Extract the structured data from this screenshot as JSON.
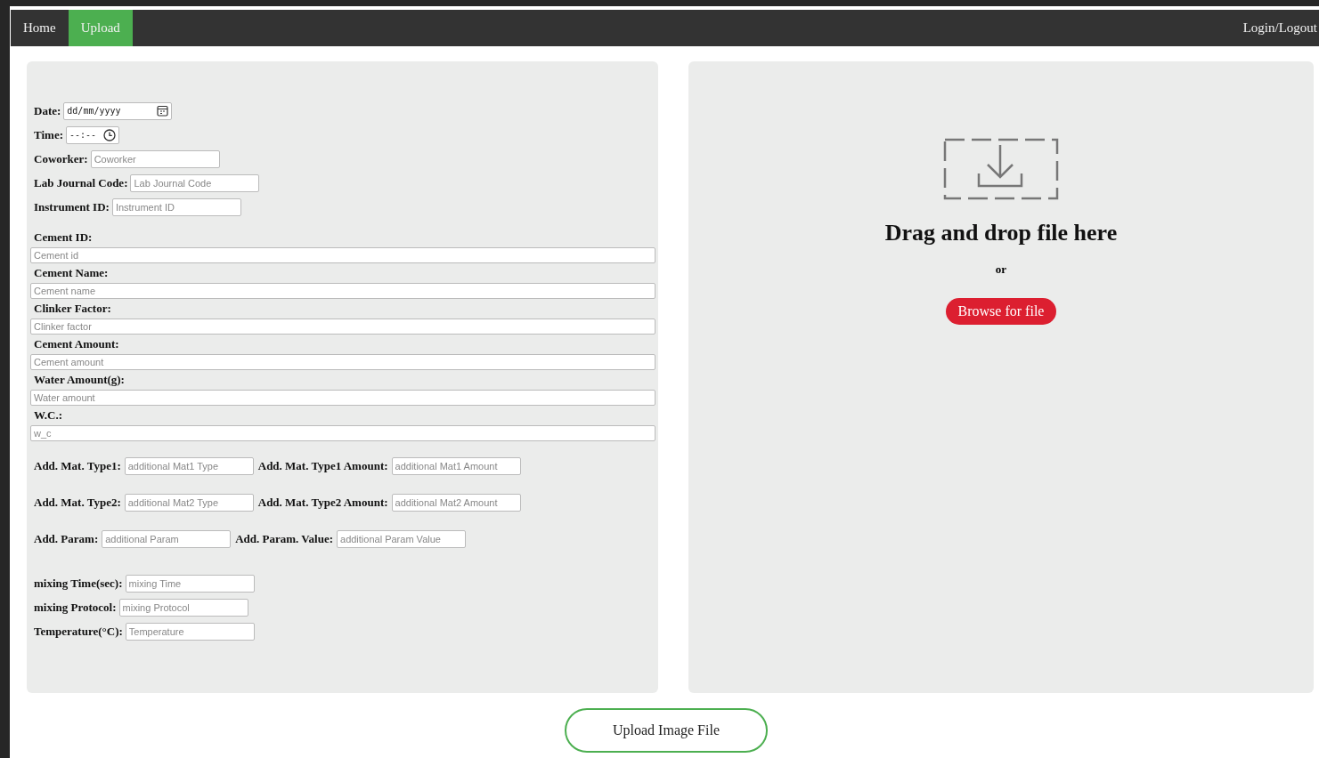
{
  "nav": {
    "items": [
      {
        "label": "Home",
        "selected": false
      },
      {
        "label": "Upload",
        "selected": true
      }
    ],
    "account_link": "Login/Logout"
  },
  "form": {
    "fields": [
      {
        "kind": "date",
        "label": "Date:",
        "value": "dd/mm/yyyy"
      },
      {
        "kind": "time",
        "label": "Time:",
        "value": "--:--"
      },
      {
        "kind": "text",
        "label": "Coworker:",
        "placeholder": "Coworker"
      },
      {
        "kind": "text",
        "label": "Lab Journal Code:",
        "placeholder": "Lab Journal Code"
      },
      {
        "kind": "text",
        "label": "Instrument ID:",
        "placeholder": "Instrument ID"
      },
      {
        "kind": "wide",
        "label": "Cement ID:",
        "placeholder": "Cement id"
      },
      {
        "kind": "wide",
        "label": "Cement Name:",
        "placeholder": "Cement name"
      },
      {
        "kind": "wide",
        "label": "Clinker Factor:",
        "placeholder": "Clinker factor"
      },
      {
        "kind": "wide",
        "label": "Cement Amount:",
        "placeholder": "Cement amount"
      },
      {
        "kind": "wide",
        "label": "Water Amount(g):",
        "placeholder": "Water amount"
      },
      {
        "kind": "wide",
        "label": "W.C.:",
        "placeholder": "w_c"
      },
      {
        "kind": "pair",
        "fields": [
          {
            "label": "Add. Mat. Type1:",
            "placeholder": "additional Mat1 Type"
          },
          {
            "label": "Add. Mat. Type1 Amount:",
            "placeholder": "additional Mat1 Amount"
          }
        ]
      },
      {
        "kind": "pair",
        "fields": [
          {
            "label": "Add. Mat. Type2:",
            "placeholder": "additional Mat2 Type"
          },
          {
            "label": "Add. Mat. Type2 Amount:",
            "placeholder": "additional Mat2 Amount"
          }
        ]
      },
      {
        "kind": "pair",
        "fields": [
          {
            "label": "Add. Param:",
            "placeholder": "additional Param"
          },
          {
            "label": "Add. Param. Value:",
            "placeholder": "additional Param Value"
          }
        ]
      },
      {
        "kind": "text",
        "label": "mixing Time(sec):",
        "placeholder": "mixing Time"
      },
      {
        "kind": "text",
        "label": "mixing Protocol:",
        "placeholder": "mixing Protocol"
      },
      {
        "kind": "text",
        "label": "Temperature(°C):",
        "placeholder": "Temperature"
      }
    ]
  },
  "dropzone": {
    "title": "Drag and drop file here",
    "separator": "or",
    "browse_button": "Browse for file"
  },
  "upload_button": "Upload Image File"
}
